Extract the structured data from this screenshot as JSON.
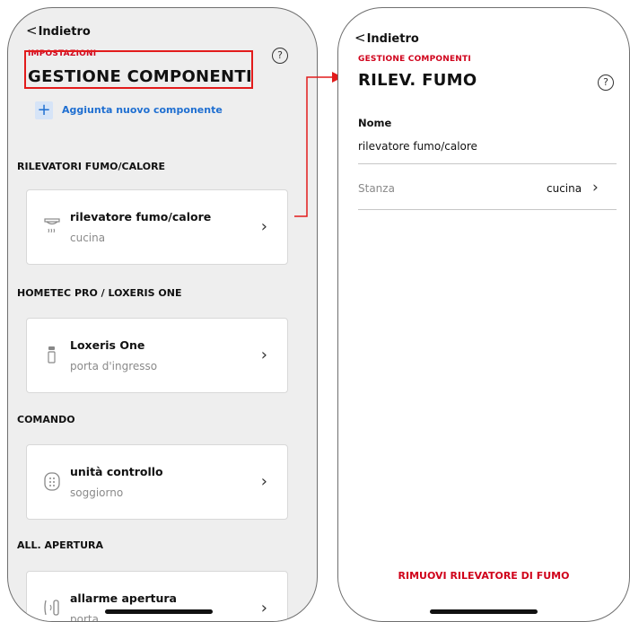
{
  "screen_left": {
    "back_label": "Indietro",
    "help_icon": "?",
    "breadcrumb": "IMPOSTAZIONI",
    "title": "GESTIONE COMPONENTI",
    "add_button_label": "Aggiunta nuovo componente",
    "sections": [
      {
        "title": "RILEVATORI FUMO/CALORE",
        "item_name": "rilevatore fumo/calore",
        "item_room": "cucina",
        "icon": "smoke-detector-icon"
      },
      {
        "title": "HOMETEC PRO / LOXERIS ONE",
        "item_name": "Loxeris One",
        "item_room": "porta d'ingresso",
        "icon": "lock-icon"
      },
      {
        "title": "COMANDO",
        "item_name": "unità controllo",
        "item_room": "soggiorno",
        "icon": "keypad-icon"
      },
      {
        "title": "ALL. APERTURA",
        "item_name": "allarme apertura",
        "item_room": "porta",
        "icon": "door-sensor-icon"
      }
    ]
  },
  "screen_right": {
    "back_label": "Indietro",
    "help_icon": "?",
    "breadcrumb": "GESTIONE COMPONENTI",
    "title": "RILEV. FUMO",
    "name_label": "Nome",
    "name_value": "rilevatore fumo/calore",
    "room_label": "Stanza",
    "room_value": "cucina",
    "remove_button_label": "RIMUOVI RILEVATORE DI FUMO"
  },
  "colors": {
    "accent_red": "#d0021b",
    "link_blue": "#1f6fd1",
    "annotation_red": "#e21b1b"
  }
}
